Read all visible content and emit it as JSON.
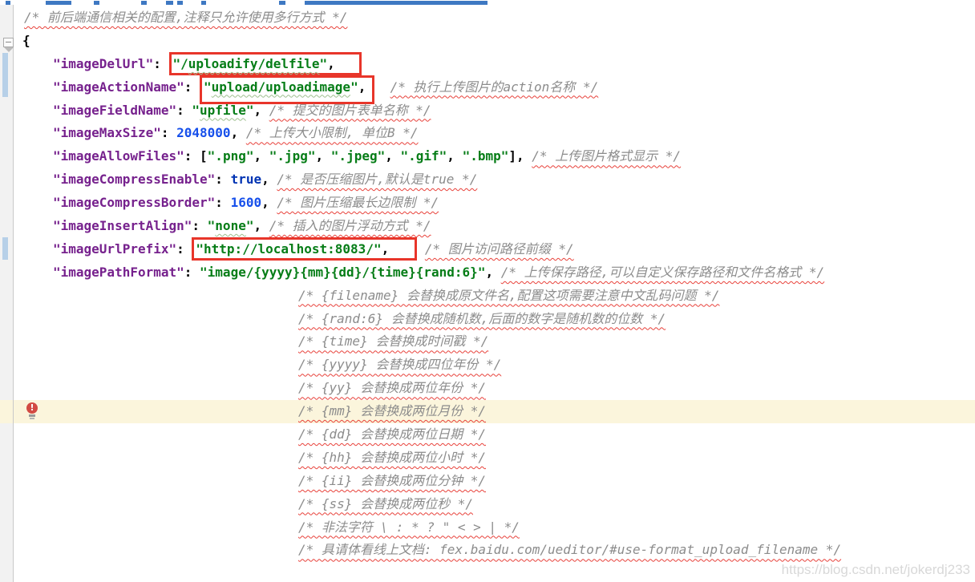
{
  "window": {
    "type": "code-editor",
    "file_language": "json",
    "watermark": "https://blog.csdn.net/jokerdj233"
  },
  "colors": {
    "key": "#76218d",
    "string": "#067d17",
    "number": "#1750eb",
    "keyword": "#0033b3",
    "comment": "#8c8c8c",
    "squiggle-red": "#e8413a",
    "squiggle-green": "#9fbf8f",
    "box-red": "#e8352a",
    "gutter-bg": "#f2f2f2",
    "gutter-border": "#c9c9c9",
    "changebar": "#b7d0e8",
    "highlight-line": "#fbf5dc",
    "bulb-red": "#d24a43",
    "tab-blue": "#3e78c2",
    "watermark": "#d8d8d8"
  },
  "editor": {
    "lines": [
      {
        "indent": 30,
        "segments": [
          {
            "t": "/* 前后端通信相关的配置,注释只允许使用多行方式 */",
            "type": "comment"
          }
        ]
      },
      {
        "indent": 28,
        "segments": [
          {
            "t": "{",
            "type": "punct"
          }
        ]
      },
      {
        "indent": 66,
        "segments": [
          {
            "t": "\"imageDelUrl\"",
            "type": "key"
          },
          {
            "t": ": ",
            "type": "punct"
          },
          {
            "box": "box1",
            "segments": [
              {
                "t": "\"/",
                "type": "string"
              },
              {
                "t": "uploadify/delfile",
                "type": "string",
                "sq": "green"
              },
              {
                "t": "\"",
                "type": "string"
              },
              {
                "t": ",",
                "type": "punct"
              }
            ]
          }
        ]
      },
      {
        "indent": 66,
        "segments": [
          {
            "t": "\"imageActionName\"",
            "type": "key"
          },
          {
            "t": ": ",
            "type": "punct"
          },
          {
            "box": "box2",
            "segments": [
              {
                "t": "\"",
                "type": "string"
              },
              {
                "t": "upload/uploadimage",
                "type": "string",
                "sq": "green"
              },
              {
                "t": "\"",
                "type": "string"
              },
              {
                "t": ",",
                "type": "punct"
              }
            ]
          },
          {
            "t": "  ",
            "type": "punct"
          },
          {
            "t": "/* 执行上传图片的action名称 */",
            "type": "comment"
          }
        ]
      },
      {
        "indent": 66,
        "segments": [
          {
            "t": "\"imageFieldName\"",
            "type": "key"
          },
          {
            "t": ": ",
            "type": "punct"
          },
          {
            "t": "\"",
            "type": "string"
          },
          {
            "t": "upfile",
            "type": "string",
            "sq": "green"
          },
          {
            "t": "\"",
            "type": "string"
          },
          {
            "t": ", ",
            "type": "punct"
          },
          {
            "t": "/* 提交的图片表单名称 */",
            "type": "comment"
          }
        ]
      },
      {
        "indent": 66,
        "segments": [
          {
            "t": "\"imageMaxSize\"",
            "type": "key"
          },
          {
            "t": ": ",
            "type": "punct"
          },
          {
            "t": "2048000",
            "type": "number"
          },
          {
            "t": ", ",
            "type": "punct"
          },
          {
            "t": "/* 上传大小限制, 单位B */",
            "type": "comment"
          }
        ]
      },
      {
        "indent": 66,
        "segments": [
          {
            "t": "\"imageAllowFiles\"",
            "type": "key"
          },
          {
            "t": ": [",
            "type": "punct"
          },
          {
            "t": "\".png\"",
            "type": "string"
          },
          {
            "t": ", ",
            "type": "punct"
          },
          {
            "t": "\".jpg\"",
            "type": "string"
          },
          {
            "t": ", ",
            "type": "punct"
          },
          {
            "t": "\".jpeg\"",
            "type": "string"
          },
          {
            "t": ", ",
            "type": "punct"
          },
          {
            "t": "\".gif\"",
            "type": "string"
          },
          {
            "t": ", ",
            "type": "punct"
          },
          {
            "t": "\".bmp\"",
            "type": "string"
          },
          {
            "t": "], ",
            "type": "punct"
          },
          {
            "t": "/* 上传图片格式显示 */",
            "type": "comment"
          }
        ]
      },
      {
        "indent": 66,
        "segments": [
          {
            "t": "\"imageCompressEnable\"",
            "type": "key"
          },
          {
            "t": ": ",
            "type": "punct"
          },
          {
            "t": "true",
            "type": "keyword"
          },
          {
            "t": ", ",
            "type": "punct"
          },
          {
            "t": "/* 是否压缩图片,默认是true */",
            "type": "comment"
          }
        ]
      },
      {
        "indent": 66,
        "segments": [
          {
            "t": "\"imageCompressBorder\"",
            "type": "key"
          },
          {
            "t": ": ",
            "type": "punct"
          },
          {
            "t": "1600",
            "type": "number"
          },
          {
            "t": ", ",
            "type": "punct"
          },
          {
            "t": "/* 图片压缩最长边限制 */",
            "type": "comment"
          }
        ]
      },
      {
        "indent": 66,
        "segments": [
          {
            "t": "\"imageInsertAlign\"",
            "type": "key"
          },
          {
            "t": ": ",
            "type": "punct"
          },
          {
            "t": "\"",
            "type": "string"
          },
          {
            "t": "none",
            "type": "string",
            "sq": "green"
          },
          {
            "t": "\"",
            "type": "string"
          },
          {
            "t": ", ",
            "type": "punct"
          },
          {
            "t": "/* 插入的图片浮动方式 */",
            "type": "comment"
          }
        ]
      },
      {
        "indent": 66,
        "segments": [
          {
            "t": "\"imageUrlPrefix\"",
            "type": "key"
          },
          {
            "t": ": ",
            "type": "punct"
          },
          {
            "box": "box3",
            "segments": [
              {
                "t": "\"http://localhost:8083/\"",
                "type": "string"
              },
              {
                "t": ",",
                "type": "punct"
              }
            ]
          },
          {
            "t": " ",
            "type": "punct"
          },
          {
            "t": "/* 图片访问路径前缀 */",
            "type": "comment"
          }
        ]
      },
      {
        "indent": 66,
        "segments": [
          {
            "t": "\"imagePathFormat\"",
            "type": "key"
          },
          {
            "t": ": ",
            "type": "punct"
          },
          {
            "t": "\"image/{yyyy}{mm}{dd}/{time}{rand:6}\"",
            "type": "string"
          },
          {
            "t": ", ",
            "type": "punct"
          },
          {
            "t": "/* 上传保存路径,可以自定义保存路径和文件名格式 */",
            "type": "comment"
          }
        ]
      },
      {
        "indent": 372,
        "segments": [
          {
            "t": "/* {filename} 会替换成原文件名,配置这项需要注意中文乱码问题 */",
            "type": "comment"
          }
        ]
      },
      {
        "indent": 372,
        "segments": [
          {
            "t": "/* {rand:6} 会替换成随机数,后面的数字是随机数的位数 */",
            "type": "comment"
          }
        ]
      },
      {
        "indent": 372,
        "segments": [
          {
            "t": "/* {time} 会替换成时间戳 */",
            "type": "comment"
          }
        ]
      },
      {
        "indent": 372,
        "segments": [
          {
            "t": "/* {yyyy} 会替换成四位年份 */",
            "type": "comment"
          }
        ]
      },
      {
        "indent": 372,
        "segments": [
          {
            "t": "/* {yy} 会替换成两位年份 */",
            "type": "comment"
          }
        ]
      },
      {
        "indent": 372,
        "highlight": true,
        "bulb": true,
        "bulb_glyph": "!",
        "segments": [
          {
            "t": "/* {mm} 会替换成两位月份 */",
            "type": "comment"
          }
        ]
      },
      {
        "indent": 372,
        "segments": [
          {
            "t": "/* {dd} 会替换成两位日期 */",
            "type": "comment"
          }
        ]
      },
      {
        "indent": 372,
        "segments": [
          {
            "t": "/* {hh} 会替换成两位小时 */",
            "type": "comment"
          }
        ]
      },
      {
        "indent": 372,
        "segments": [
          {
            "t": "/* {ii} 会替换成两位分钟 */",
            "type": "comment"
          }
        ]
      },
      {
        "indent": 372,
        "segments": [
          {
            "t": "/* {ss} 会替换成两位秒 */",
            "type": "comment"
          }
        ]
      },
      {
        "indent": 372,
        "segments": [
          {
            "t": "/* 非法字符 \\ : * ? \" < > | */",
            "type": "comment"
          }
        ]
      },
      {
        "indent": 372,
        "segments": [
          {
            "t": "/* 具请体看线上文档: fex.baidu.com/ueditor/#use-format_upload_filename */",
            "type": "comment"
          }
        ]
      }
    ]
  }
}
